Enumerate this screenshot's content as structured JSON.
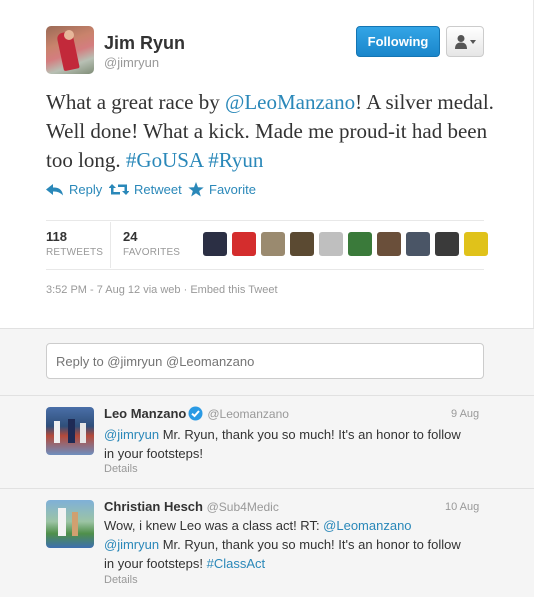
{
  "author": {
    "name": "Jim Ryun",
    "handle": "@jimryun"
  },
  "follow_button": {
    "label": "Following"
  },
  "tweet": {
    "text_part1": "What a great race by ",
    "mention1": "@LeoManzano",
    "text_part2": "! A silver medal. Well done! What a kick. Made me proud-it had been too long. ",
    "hashtag1": "#GoUSA",
    "space": " ",
    "hashtag2": "#Ryun"
  },
  "actions": {
    "reply": "Reply",
    "retweet": "Retweet",
    "favorite": "Favorite"
  },
  "stats": {
    "retweets_count": "118",
    "retweets_label": "RETWEETS",
    "favorites_count": "24",
    "favorites_label": "FAVORITES"
  },
  "favoriter_avatars": [
    {
      "color": "#2b2f44"
    },
    {
      "color": "#d42d2d"
    },
    {
      "color": "#9a8a6f"
    },
    {
      "color": "#5b4a32"
    },
    {
      "color": "#bfbfbf"
    },
    {
      "color": "#3a7a3a"
    },
    {
      "color": "#6a4f3a"
    },
    {
      "color": "#4a5566"
    },
    {
      "color": "#3a3a3a"
    },
    {
      "color": "#e0c21a"
    }
  ],
  "meta": {
    "timestamp": "3:52 PM - 7 Aug 12 via web",
    "separator": " · ",
    "embed": "Embed this Tweet"
  },
  "reply_input": {
    "placeholder": "Reply to @jimryun @Leomanzano"
  },
  "replies": [
    {
      "name": "Leo Manzano",
      "handle": "@Leomanzano",
      "verified": true,
      "date": "9 Aug",
      "mention": "@jimryun",
      "text": " Mr. Ryun, thank you so much! It's an honor to follow in your footsteps!",
      "details": "Details"
    },
    {
      "name": "Christian Hesch",
      "handle": "@Sub4Medic",
      "verified": false,
      "date": "10 Aug",
      "text_a": "Wow, i knew Leo was a class act! RT: ",
      "mention_a": "@Leomanzano",
      "space": " ",
      "mention_b": "@jimryun",
      "text_b": " Mr. Ryun, thank you so much! It's an honor to follow in your footsteps! ",
      "hashtag": "#ClassAct",
      "details": "Details"
    }
  ],
  "colors": {
    "link": "#2a88b9",
    "follow_button": "#1a86cb",
    "muted": "#999999"
  }
}
